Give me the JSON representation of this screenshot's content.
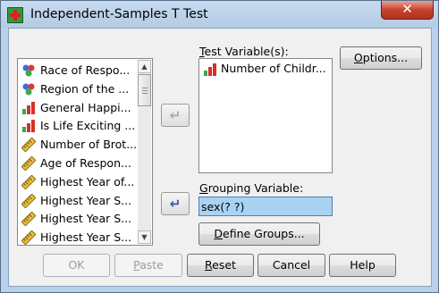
{
  "window": {
    "title": "Independent-Samples T Test",
    "close_glyph": "✕"
  },
  "variables_list": {
    "items": [
      {
        "label": "Race of Respo...",
        "icon": "nominal-icon"
      },
      {
        "label": "Region of the ...",
        "icon": "nominal-icon"
      },
      {
        "label": "General Happi...",
        "icon": "ordinal-icon"
      },
      {
        "label": "Is Life Exciting ...",
        "icon": "ordinal-icon"
      },
      {
        "label": "Number of Brot...",
        "icon": "scale-icon"
      },
      {
        "label": "Age of Respon...",
        "icon": "scale-icon"
      },
      {
        "label": "Highest Year of...",
        "icon": "scale-icon"
      },
      {
        "label": "Highest Year S...",
        "icon": "scale-icon"
      },
      {
        "label": "Highest Year S...",
        "icon": "scale-icon"
      },
      {
        "label": "Highest Year S...",
        "icon": "scale-icon"
      }
    ]
  },
  "test_variables": {
    "label_pre": "",
    "label_mnemonic": "T",
    "label_post": "est Variable(s):",
    "items": [
      {
        "label": "Number of Childr...",
        "icon": "ordinal-icon"
      }
    ]
  },
  "grouping": {
    "label_mnemonic": "G",
    "label_post": "rouping Variable:",
    "value": "sex(? ?)"
  },
  "arrow_glyph": "↵",
  "buttons": {
    "options": {
      "mnemonic": "O",
      "rest": "ptions..."
    },
    "define_groups": {
      "mnemonic": "D",
      "rest": "efine Groups..."
    },
    "ok": "OK",
    "paste": {
      "mnemonic": "P",
      "rest": "aste"
    },
    "reset": {
      "mnemonic": "R",
      "rest": "eset"
    },
    "cancel": "Cancel",
    "help": "Help"
  },
  "colors": {
    "nominal_red": "#d63a3a",
    "nominal_blue": "#3a6fd6",
    "nominal_green": "#3aa84a",
    "ordinal_red": "#d8302a",
    "scale_yellow": "#e8c040",
    "highlight": "#a9d3f3"
  }
}
